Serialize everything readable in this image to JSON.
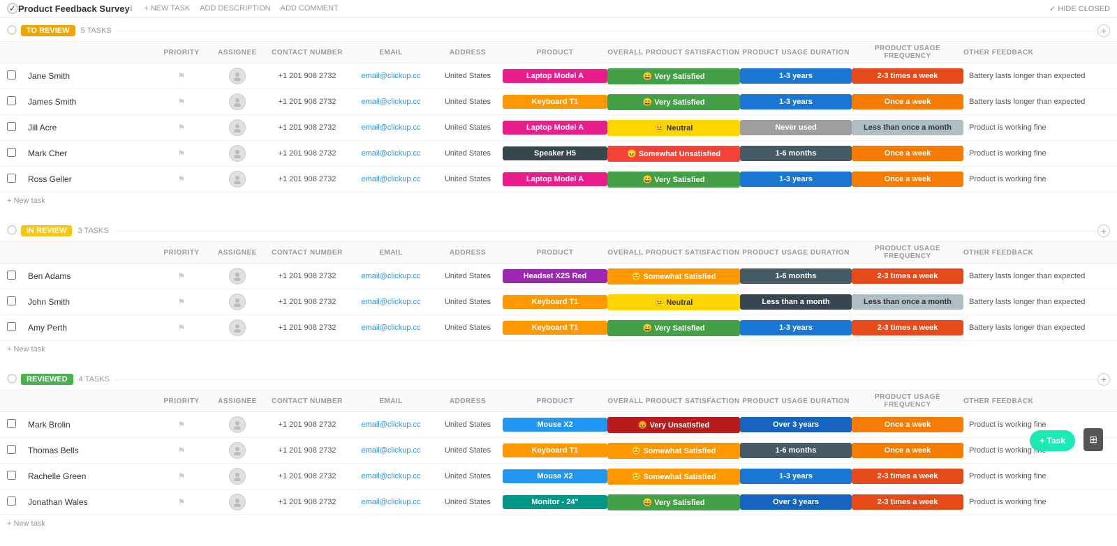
{
  "app": {
    "title": "Product Feedback Survey",
    "actions": [
      "+ NEW TASK",
      "ADD DESCRIPTION",
      "ADD COMMENT"
    ],
    "hide_closed": "✓ HIDE CLOSED"
  },
  "columns": {
    "priority": "PRIORITY",
    "assignee": "ASSIGNEE",
    "contact": "CONTACT NUMBER",
    "email": "EMAIL",
    "address": "ADDRESS",
    "product": "PRODUCT",
    "satisfaction": "OVERALL PRODUCT SATISFACTION",
    "duration": "PRODUCT USAGE DURATION",
    "frequency": "PRODUCT USAGE FREQUENCY",
    "feedback": "OTHER FEEDBACK"
  },
  "sections": [
    {
      "id": "to-review",
      "label": "TO REVIEW",
      "badge_class": "badge-toreview",
      "count": "5 TASKS",
      "tasks": [
        {
          "name": "Jane Smith",
          "priority": "flag",
          "contact": "+1 201 908 2732",
          "email": "email@clickup.cc",
          "address": "United States",
          "product": "Laptop Model A",
          "product_color": "tag-pink",
          "satisfaction": "😄 Very Satisfied",
          "satisfaction_color": "sat-very-satisfied",
          "duration": "1-3 years",
          "duration_color": "dur-1-3",
          "frequency": "2-3 times a week",
          "frequency_color": "freq-2-3",
          "other_feedback": "Battery lasts longer than expected"
        },
        {
          "name": "James Smith",
          "priority": "flag",
          "contact": "+1 201 908 2732",
          "email": "email@clickup.cc",
          "address": "United States",
          "product": "Keyboard T1",
          "product_color": "tag-orange",
          "satisfaction": "😄 Very Satisfied",
          "satisfaction_color": "sat-very-satisfied",
          "duration": "1-3 years",
          "duration_color": "dur-1-3",
          "frequency": "Once a week",
          "frequency_color": "freq-once",
          "other_feedback": "Battery lasts longer than expected"
        },
        {
          "name": "Jill Acre",
          "priority": "flag",
          "contact": "+1 201 908 2732",
          "email": "email@clickup.cc",
          "address": "United States",
          "product": "Laptop Model A",
          "product_color": "tag-pink",
          "satisfaction": "😐 Neutral",
          "satisfaction_color": "sat-neutral",
          "duration": "Never used",
          "duration_color": "dur-never",
          "frequency": "Less than once a month",
          "frequency_color": "freq-less-once",
          "other_feedback": "Product is working fine"
        },
        {
          "name": "Mark Cher",
          "priority": "flag",
          "contact": "+1 201 908 2732",
          "email": "email@clickup.cc",
          "address": "United States",
          "product": "Speaker H5",
          "product_color": "tag-dark",
          "satisfaction": "😠 Somewhat Unsatisfied",
          "satisfaction_color": "sat-somewhat-unsatisfied",
          "duration": "1-6 months",
          "duration_color": "dur-1-6",
          "frequency": "Once a week",
          "frequency_color": "freq-once",
          "other_feedback": "Product is working fine"
        },
        {
          "name": "Ross Geller",
          "priority": "flag",
          "contact": "+1 201 908 2732",
          "email": "email@clickup.cc",
          "address": "United States",
          "product": "Laptop Model A",
          "product_color": "tag-pink",
          "satisfaction": "😄 Very Satisfied",
          "satisfaction_color": "sat-very-satisfied",
          "duration": "1-3 years",
          "duration_color": "dur-1-3",
          "frequency": "Once a week",
          "frequency_color": "freq-once",
          "other_feedback": "Product is working fine"
        }
      ],
      "new_task_label": "+ New task"
    },
    {
      "id": "in-review",
      "label": "IN REVIEW",
      "badge_class": "badge-inreview",
      "count": "3 TASKS",
      "tasks": [
        {
          "name": "Ben Adams",
          "priority": "flag",
          "contact": "+1 201 908 2732",
          "email": "email@clickup.cc",
          "address": "United States",
          "product": "Headset X2S Red",
          "product_color": "tag-purple",
          "satisfaction": "😊 Somewhat Satisfied",
          "satisfaction_color": "sat-somewhat-satisfied",
          "duration": "1-6 months",
          "duration_color": "dur-1-6",
          "frequency": "2-3 times a week",
          "frequency_color": "freq-2-3",
          "other_feedback": "Battery lasts longer than expected"
        },
        {
          "name": "John Smith",
          "priority": "flag",
          "contact": "+1 201 908 2732",
          "email": "email@clickup.cc",
          "address": "United States",
          "product": "Keyboard T1",
          "product_color": "tag-orange",
          "satisfaction": "😐 Neutral",
          "satisfaction_color": "sat-neutral",
          "duration": "Less than a month",
          "duration_color": "dur-less",
          "frequency": "Less than once a month",
          "frequency_color": "freq-less-once",
          "other_feedback": "Battery lasts longer than expected"
        },
        {
          "name": "Amy Perth",
          "priority": "flag",
          "contact": "+1 201 908 2732",
          "email": "email@clickup.cc",
          "address": "United States",
          "product": "Keyboard T1",
          "product_color": "tag-orange",
          "satisfaction": "😄 Very Satisfied",
          "satisfaction_color": "sat-very-satisfied",
          "duration": "1-3 years",
          "duration_color": "dur-1-3",
          "frequency": "2-3 times a week",
          "frequency_color": "freq-2-3",
          "other_feedback": "Battery lasts longer than expected"
        }
      ],
      "new_task_label": "+ New task"
    },
    {
      "id": "reviewed",
      "label": "REVIEWED",
      "badge_class": "badge-reviewed",
      "count": "4 TASKS",
      "tasks": [
        {
          "name": "Mark Brolin",
          "priority": "flag",
          "contact": "+1 201 908 2732",
          "email": "email@clickup.cc",
          "address": "United States",
          "product": "Mouse X2",
          "product_color": "tag-blue",
          "satisfaction": "😡 Very Unsatisfied",
          "satisfaction_color": "sat-very-unsatisfied",
          "duration": "Over 3 years",
          "duration_color": "dur-over3",
          "frequency": "Once a week",
          "frequency_color": "freq-once",
          "other_feedback": "Product is working fine"
        },
        {
          "name": "Thomas Bells",
          "priority": "flag",
          "contact": "+1 201 908 2732",
          "email": "email@clickup.cc",
          "address": "United States",
          "product": "Keyboard T1",
          "product_color": "tag-orange",
          "satisfaction": "😊 Somewhat Satisfied",
          "satisfaction_color": "sat-somewhat-satisfied",
          "duration": "1-6 months",
          "duration_color": "dur-1-6",
          "frequency": "Once a week",
          "frequency_color": "freq-once",
          "other_feedback": "Product is working fine"
        },
        {
          "name": "Rachelle Green",
          "priority": "flag",
          "contact": "+1 201 908 2732",
          "email": "email@clickup.cc",
          "address": "United States",
          "product": "Mouse X2",
          "product_color": "tag-blue",
          "satisfaction": "😊 Somewhat Satisfied",
          "satisfaction_color": "sat-somewhat-satisfied",
          "duration": "1-3 years",
          "duration_color": "dur-1-3",
          "frequency": "2-3 times a week",
          "frequency_color": "freq-2-3",
          "other_feedback": "Product is working fine"
        },
        {
          "name": "Jonathan Wales",
          "priority": "flag",
          "contact": "+1 201 908 2732",
          "email": "email@clickup.cc",
          "address": "United States",
          "product": "Monitor - 24\"",
          "product_color": "tag-teal",
          "satisfaction": "😄 Very Satisfied",
          "satisfaction_color": "sat-very-satisfied",
          "duration": "Over 3 years",
          "duration_color": "dur-over3",
          "frequency": "2-3 times a week",
          "frequency_color": "freq-2-3",
          "other_feedback": "Product is working fine"
        }
      ],
      "new_task_label": "+ New task"
    }
  ],
  "fab": {
    "label": "+ Task",
    "grid_icon": "⊞"
  }
}
